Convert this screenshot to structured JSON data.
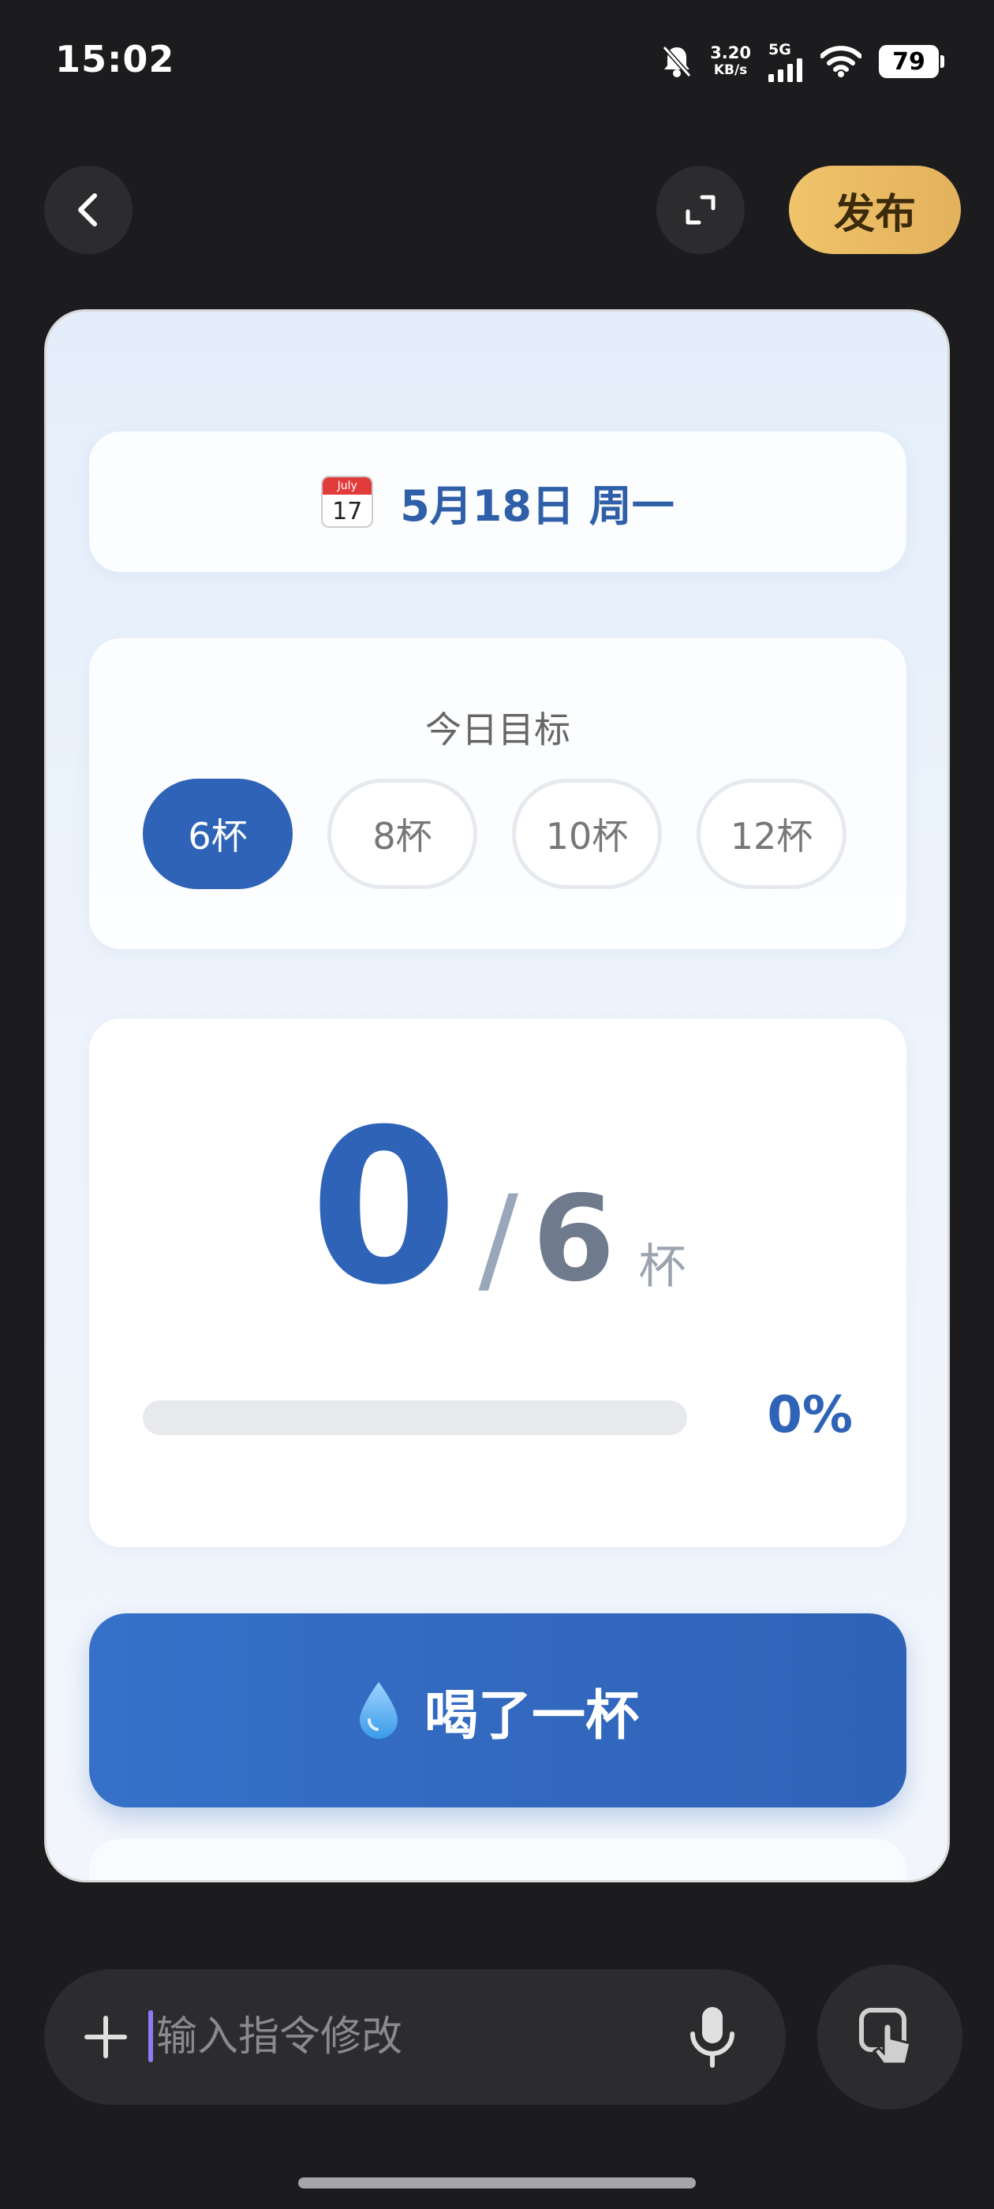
{
  "status_bar": {
    "time": "15:02",
    "net_speed_value": "3.20",
    "net_speed_unit": "KB/s",
    "network": "5G",
    "battery": "79",
    "icons": [
      "bell-muted-icon",
      "signal-icon",
      "wifi-icon",
      "battery-icon"
    ]
  },
  "top_bar": {
    "publish_label": "发布",
    "publish_color": "#e8bb62"
  },
  "app": {
    "calendar_month": "July",
    "calendar_day": "17",
    "date_text": "5月18日 周一",
    "goal": {
      "title": "今日目标",
      "options": [
        "6杯",
        "8杯",
        "10杯",
        "12杯"
      ],
      "selected_index": 0
    },
    "progress": {
      "current": "0",
      "slash": "/",
      "goal": "6",
      "unit": "杯",
      "percent_label": "0%",
      "fraction": 0
    },
    "drink_button_label": "喝了一杯",
    "accent_color": "#2e63b7"
  },
  "input": {
    "placeholder": "输入指令修改",
    "value": ""
  }
}
